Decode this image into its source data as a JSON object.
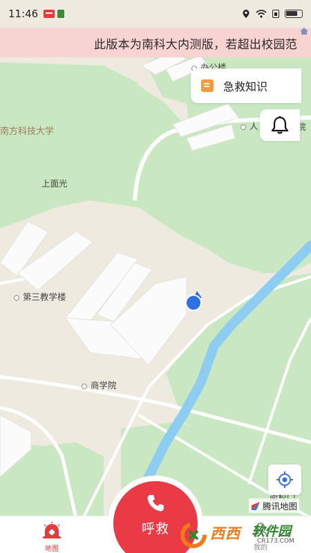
{
  "status_bar": {
    "time": "11:46"
  },
  "banner": {
    "text": "此版本为南科大内测版，若超出校园范"
  },
  "map": {
    "labels": {
      "office": "办公楼",
      "ren": "人",
      "yuan": "院",
      "campus": "南方科技大学",
      "shangmianguang": "上面光",
      "teaching3": "第三教学楼",
      "business": "商学院",
      "south_gate": "南校门"
    }
  },
  "knowledge_card": {
    "label": "急救知识",
    "icon": "document-icon"
  },
  "bell": {
    "icon": "bell-icon"
  },
  "locate": {
    "icon": "locate-icon"
  },
  "map_provider": {
    "label": "腾讯地图"
  },
  "tabbar": {
    "map_label": "地图",
    "mine_label": "我的"
  },
  "sos": {
    "label": "呼救",
    "icon": "phone-icon"
  },
  "watermark": {
    "main": "西西",
    "secondary": "软件园",
    "sub": "CR173.COM"
  },
  "colors": {
    "accent_red": "#ea3a45",
    "banner_bg": "#f7d4d1",
    "map_green": "#c9e8c2",
    "river_blue": "#8ecdf2",
    "user_dot": "#2f6fe4"
  }
}
